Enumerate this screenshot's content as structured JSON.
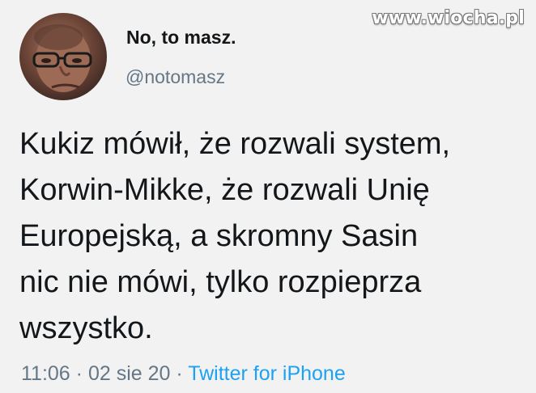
{
  "watermark": "www.wiocha.pl",
  "author": {
    "display_name": "No, to masz.",
    "handle": "@notomasz",
    "avatar_icon": "user-avatar"
  },
  "tweet": {
    "lines": [
      "Kukiz mówił, że rozwali system,",
      "Korwin-Mikke, że rozwali Unię",
      "Europejską, a skromny Sasin",
      "nic nie mówi, tylko rozpieprza",
      "wszystko."
    ]
  },
  "meta": {
    "time": "11:06",
    "separator": "·",
    "date": "02 sie 20",
    "source": "Twitter for iPhone"
  },
  "colors": {
    "background": "#f2f2f2",
    "text": "#14171a",
    "secondary": "#657786",
    "link": "#1da1f2"
  }
}
